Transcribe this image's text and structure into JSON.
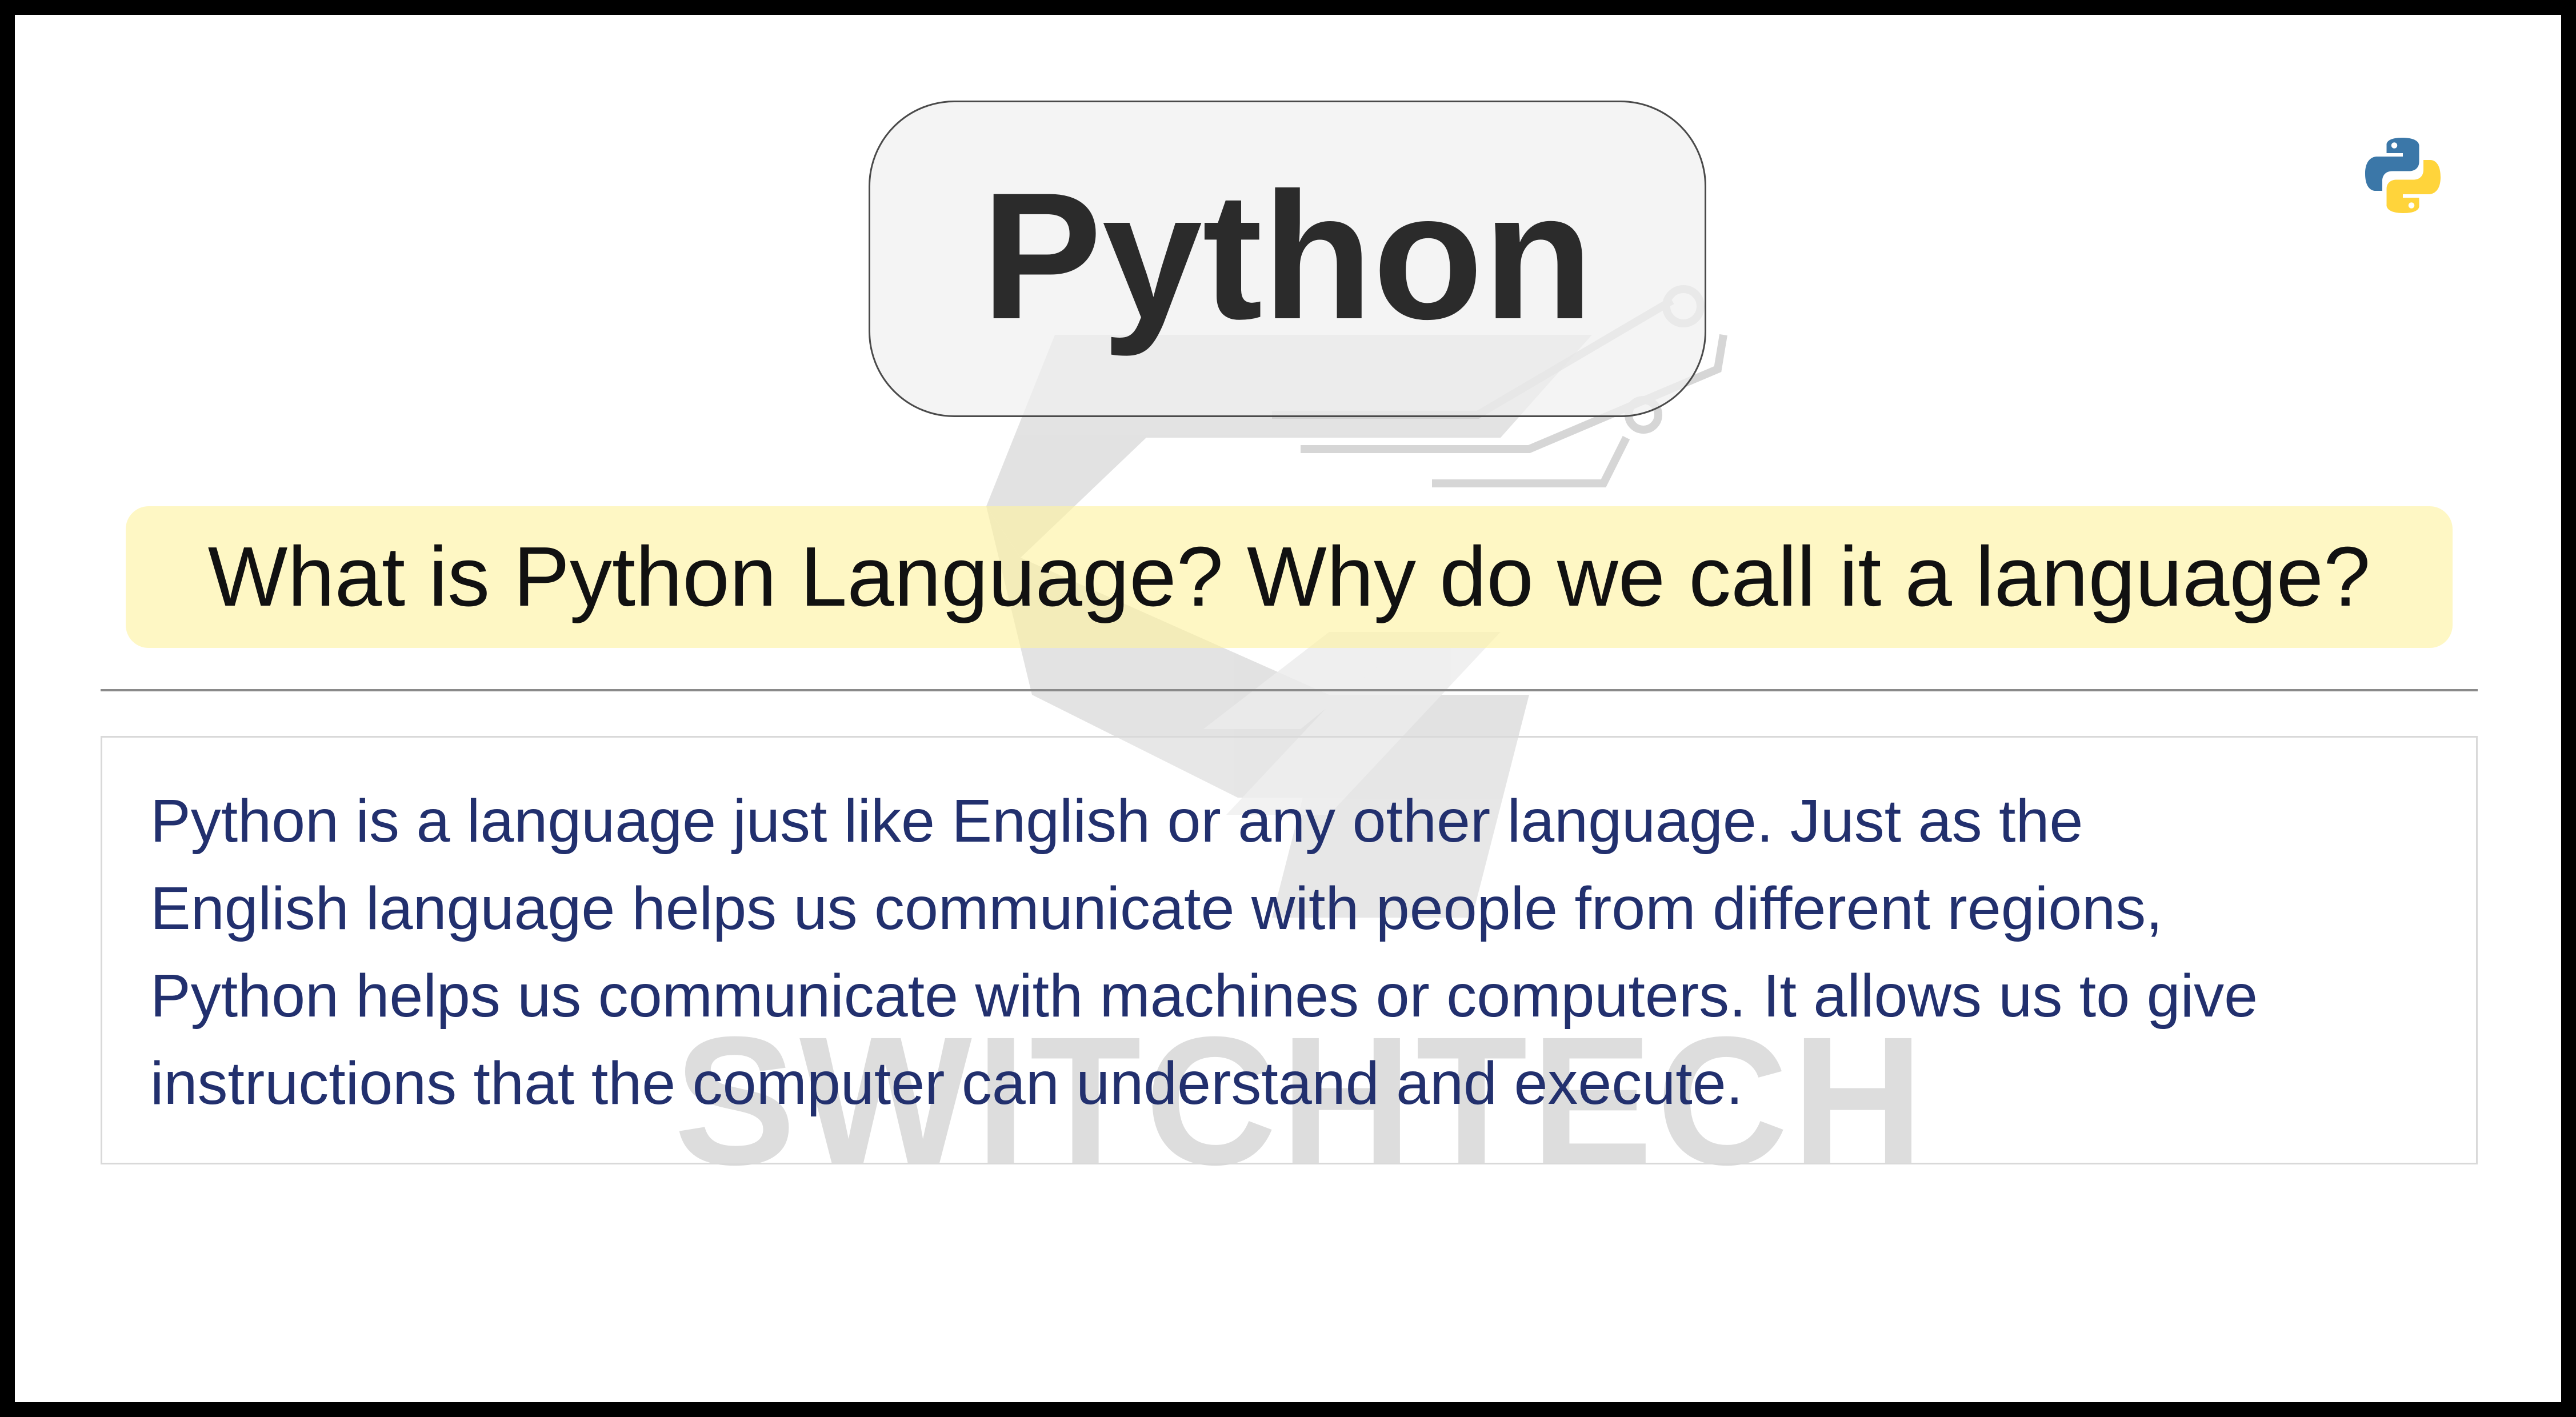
{
  "title": "Python",
  "question": "What is Python Language? Why do we call it a language?",
  "body_lines": [
    "Python is a language just like English or any other language. Just as the",
    "English language helps us communicate with people from different regions,",
    "Python helps us communicate with machines or computers. It allows us to give",
    "instructions that the computer can understand and execute."
  ],
  "watermark": "SWITCHTECH",
  "logo_icon": "python-logo-icon",
  "colors": {
    "frame": "#000000",
    "title_text": "#2b2b2b",
    "question_bg": "#fdf2a0",
    "body_text": "#22306e",
    "python_blue": "#3b77a8",
    "python_yellow": "#ffd43b"
  }
}
